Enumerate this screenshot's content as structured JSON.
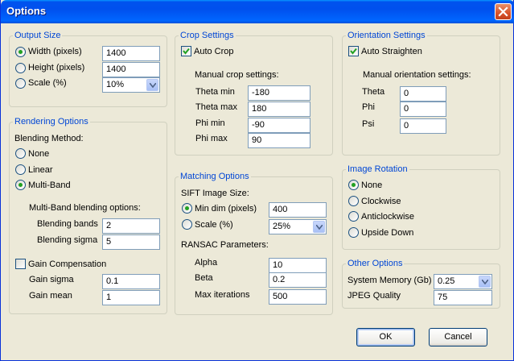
{
  "window": {
    "title": "Options"
  },
  "output_size": {
    "legend": "Output Size",
    "width_label": "Width (pixels)",
    "width_value": "1400",
    "height_label": "Height (pixels)",
    "height_value": "1400",
    "scale_label": "Scale (%)",
    "scale_value": "10%",
    "selected": "width"
  },
  "rendering": {
    "legend": "Rendering Options",
    "blending_method_label": "Blending Method:",
    "none_label": "None",
    "linear_label": "Linear",
    "multiband_label": "Multi-Band",
    "selected": "multiband",
    "multiband_options_label": "Multi-Band blending options:",
    "bands_label": "Blending bands",
    "bands_value": "2",
    "sigma_label": "Blending sigma",
    "sigma_value": "5",
    "gain_comp_label": "Gain Compensation",
    "gain_comp_checked": false,
    "gain_sigma_label": "Gain sigma",
    "gain_sigma_value": "0.1",
    "gain_mean_label": "Gain mean",
    "gain_mean_value": "1"
  },
  "crop": {
    "legend": "Crop Settings",
    "auto_crop_label": "Auto Crop",
    "auto_crop_checked": true,
    "manual_label": "Manual crop settings:",
    "theta_min_label": "Theta min",
    "theta_min_value": "-180",
    "theta_max_label": "Theta max",
    "theta_max_value": "180",
    "phi_min_label": "Phi min",
    "phi_min_value": "-90",
    "phi_max_label": "Phi max",
    "phi_max_value": "90"
  },
  "matching": {
    "legend": "Matching Options",
    "sift_label": "SIFT Image Size:",
    "min_dim_label": "Min dim (pixels)",
    "min_dim_value": "400",
    "scale_label": "Scale (%)",
    "scale_value": "25%",
    "selected": "min_dim",
    "ransac_label": "RANSAC Parameters:",
    "alpha_label": "Alpha",
    "alpha_value": "10",
    "beta_label": "Beta",
    "beta_value": "0.2",
    "max_iter_label": "Max iterations",
    "max_iter_value": "500"
  },
  "orientation": {
    "legend": "Orientation Settings",
    "auto_straighten_label": "Auto Straighten",
    "auto_straighten_checked": true,
    "manual_label": "Manual orientation settings:",
    "theta_label": "Theta",
    "theta_value": "0",
    "phi_label": "Phi",
    "phi_value": "0",
    "psi_label": "Psi",
    "psi_value": "0"
  },
  "rotation": {
    "legend": "Image Rotation",
    "none_label": "None",
    "clockwise_label": "Clockwise",
    "anticlockwise_label": "Anticlockwise",
    "upside_down_label": "Upside Down",
    "selected": "none"
  },
  "other": {
    "legend": "Other Options",
    "memory_label": "System Memory (Gb)",
    "memory_value": "0.25",
    "jpeg_label": "JPEG Quality",
    "jpeg_value": "75"
  },
  "buttons": {
    "ok": "OK",
    "cancel": "Cancel"
  },
  "icons": {
    "close": "close-icon",
    "check": "checkmark-icon",
    "dropdown": "chevron-down-icon"
  }
}
